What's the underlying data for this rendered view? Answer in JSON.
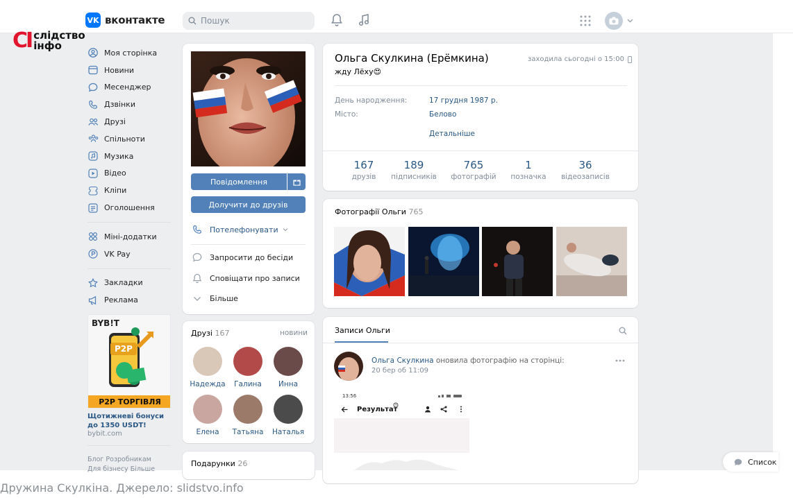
{
  "header": {
    "logo_mark": "VK",
    "logo_text": "вконтакте",
    "search_placeholder": "Пошук"
  },
  "watermark": {
    "mark": "CI",
    "line1": "слідство",
    "line2": "інфо"
  },
  "sidebar": {
    "items": [
      {
        "label": "Моя сторінка",
        "icon": "user-icon"
      },
      {
        "label": "Новини",
        "icon": "news-icon"
      },
      {
        "label": "Месенджер",
        "icon": "messenger-icon"
      },
      {
        "label": "Дзвінки",
        "icon": "phone-icon"
      },
      {
        "label": "Друзі",
        "icon": "friends-icon"
      },
      {
        "label": "Спільноти",
        "icon": "communities-icon"
      },
      {
        "label": "Музика",
        "icon": "music-icon"
      },
      {
        "label": "Відео",
        "icon": "video-icon"
      },
      {
        "label": "Кліпи",
        "icon": "clips-icon"
      },
      {
        "label": "Оголошення",
        "icon": "ads-icon"
      }
    ],
    "items2": [
      {
        "label": "Міні-додатки",
        "icon": "apps-icon"
      },
      {
        "label": "VK Pay",
        "icon": "vkpay-icon"
      }
    ],
    "items3": [
      {
        "label": "Закладки",
        "icon": "bookmark-icon"
      },
      {
        "label": "Реклама",
        "icon": "megaphone-icon"
      }
    ],
    "ad": {
      "brand": "BYB!T",
      "badge": "P2P",
      "banner": "P2P ТОРГІВЛЯ",
      "caption": "Щотижневі бонуси до 1350 USDT!",
      "url": "bybit.com"
    },
    "footer": {
      "line1": "Блог   Розробникам",
      "line2": "Для бізнесу   Більше"
    }
  },
  "profile_actions": {
    "message": "Повідомлення",
    "join": "Долучити до друзів",
    "call": "Потелефонувати",
    "invite": "Запросити до бесіди",
    "notify": "Сповіщати про записи",
    "more": "Більше"
  },
  "friends": {
    "title": "Друзі",
    "count": "167",
    "link": "новини",
    "list": [
      {
        "name": "Надежда",
        "color": "#d9c7b8"
      },
      {
        "name": "Галина",
        "color": "#b34a4a"
      },
      {
        "name": "Инна",
        "color": "#6b4a4a"
      },
      {
        "name": "Елена",
        "color": "#caa6a1"
      },
      {
        "name": "Татьяна",
        "color": "#9c7a6a"
      },
      {
        "name": "Наталья",
        "color": "#4b4b4b"
      }
    ]
  },
  "gifts": {
    "title": "Подарунки",
    "count": "26"
  },
  "profile": {
    "name": "Ольга Скулкина (Ерёмкина)",
    "status": "жду Лёху😍",
    "last_seen": "заходила сьогодні о 15:00",
    "birthday_label": "День народження:",
    "birthday_value": "17 грудня 1987 р.",
    "city_label": "Місто:",
    "city_value": "Белово",
    "details": "Детальніше"
  },
  "stats": [
    {
      "value": "167",
      "label": "друзів"
    },
    {
      "value": "189",
      "label": "підписників"
    },
    {
      "value": "765",
      "label": "фотографій"
    },
    {
      "value": "1",
      "label": "позначка"
    },
    {
      "value": "36",
      "label": "відеозаписів"
    }
  ],
  "photos": {
    "title": "Фотографії Ольги",
    "count": "765"
  },
  "wall": {
    "title": "Записи Ольги",
    "author": "Ольга Скулкина",
    "action": "оновила фотографію на сторінці:",
    "date": "20 бер об 11:09",
    "shot_time": "13:56",
    "shot_title": "Результат"
  },
  "list_button": "Список",
  "caption": "Дружина Скулкіна. Джерело: slidstvo.info",
  "colors": {
    "accent": "#5181b8",
    "link": "#2a5885",
    "bg": "#edeef0",
    "watermark_red": "#e1152d"
  }
}
